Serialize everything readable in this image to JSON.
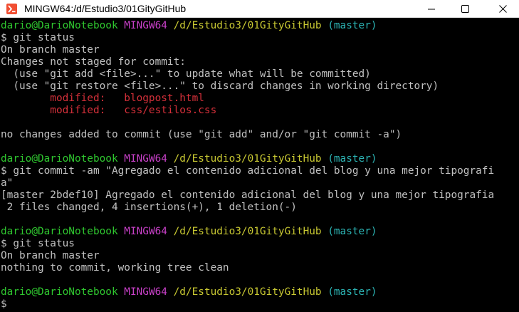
{
  "window": {
    "title": "MINGW64:/d/Estudio3/01GityGitHub",
    "icons": {
      "app": "git-bash-icon",
      "minimize": "minimize-icon",
      "maximize": "maximize-icon",
      "close": "close-icon"
    }
  },
  "colors": {
    "background": "#000000",
    "text": "#c0c0c0",
    "user": "#2fc62f",
    "msystem": "#c840c8",
    "path": "#c8c832",
    "branch": "#2cb5b5",
    "modified": "#d6303a"
  },
  "prompt": {
    "user_host": "dario@DarioNotebook",
    "msystem": "MINGW64",
    "path": "/d/Estudio3/01GityGitHub",
    "branch": "(master)"
  },
  "terminal": {
    "cmd1": "$ git status",
    "out1_l1": "On branch master",
    "out1_l2": "Changes not staged for commit:",
    "out1_l3": "  (use \"git add <file>...\" to update what will be committed)",
    "out1_l4": "  (use \"git restore <file>...\" to discard changes in working directory)",
    "mod1_label": "        modified:   ",
    "mod1_file": "blogpost.html",
    "mod2_label": "        modified:   ",
    "mod2_file": "css/estilos.css",
    "out1_l5": "no changes added to commit (use \"git add\" and/or \"git commit -a\")",
    "cmd2_l1": "$ git commit -am \"Agregado el contenido adicional del blog y una mejor tipografi",
    "cmd2_l2": "a\"",
    "out2_l1": "[master 2bdef10] Agregado el contenido adicional del blog y una mejor tipografia",
    "out2_l2": " 2 files changed, 4 insertions(+), 1 deletion(-)",
    "cmd3": "$ git status",
    "out3_l1": "On branch master",
    "out3_l2": "nothing to commit, working tree clean",
    "prompt_symbol": "$"
  }
}
